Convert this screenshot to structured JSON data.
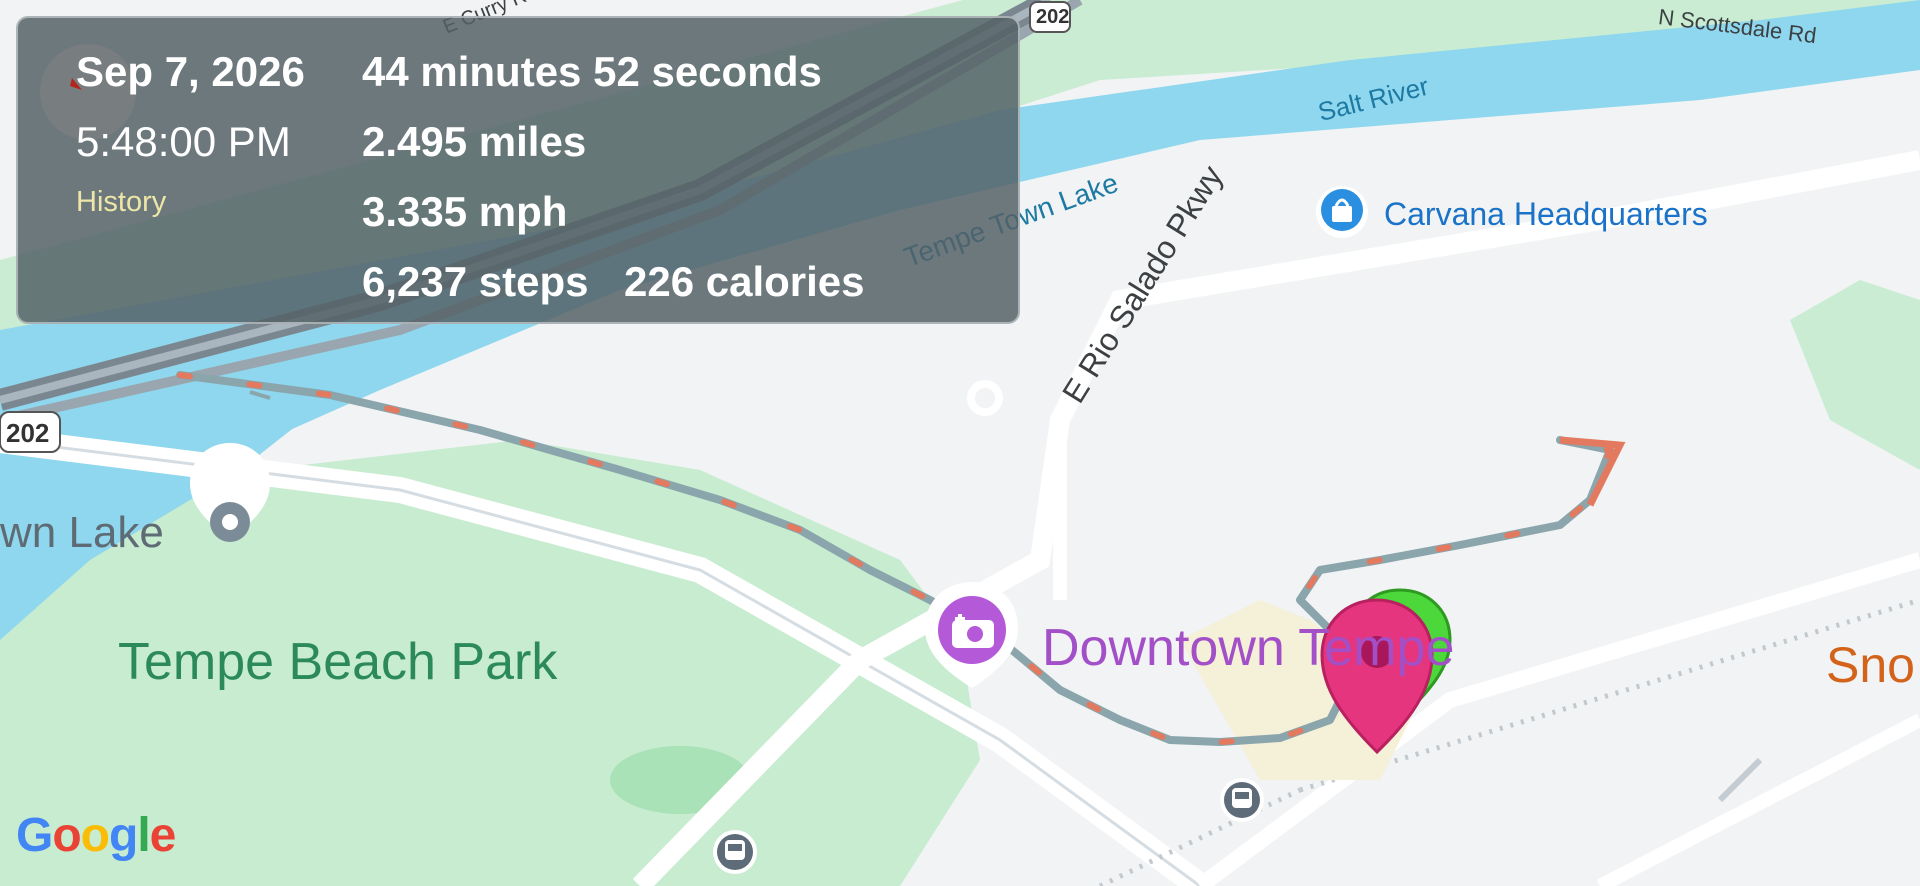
{
  "map": {
    "road_labels": {
      "rio_salado": "E Rio Salado Pkwy",
      "scottsdale": "N Scottsdale Rd",
      "curry": "E Curry Rd",
      "shield_top": "202",
      "shield_left": "202"
    },
    "water_labels": {
      "salt_river": "Salt River",
      "tempe_town_lake": "Tempe Town Lake"
    },
    "poi": {
      "carvana": "Carvana Headquarters",
      "beach_park": "Tempe Beach Park",
      "town_lake": "wn Lake",
      "downtown": "Downtown Tempe",
      "snoop": "Sno"
    },
    "attribution": "Google",
    "icons": [
      "shopping-bag-icon",
      "location-pin-icon",
      "camera-icon",
      "train-icon",
      "compass-icon",
      "start-marker-icon",
      "end-marker-icon"
    ]
  },
  "stats": {
    "date": "Sep 7, 2026",
    "time": "5:48:00 PM",
    "history_link": "History",
    "duration": "44 minutes 52 seconds",
    "distance": "2.495 miles",
    "speed": "3.335 mph",
    "steps": "6,237 steps",
    "calories": "226 calories"
  },
  "colors": {
    "water": "#8fd7ee",
    "park": "#c8eccf",
    "route": "#8aa5ac",
    "route_dash": "#e37a5f",
    "marker_end": "#e6357f",
    "marker_start": "#4cd73b",
    "poi_purple": "#a24fc8",
    "poi_green": "#2c8a5a",
    "poi_blue": "#1a73c8"
  }
}
